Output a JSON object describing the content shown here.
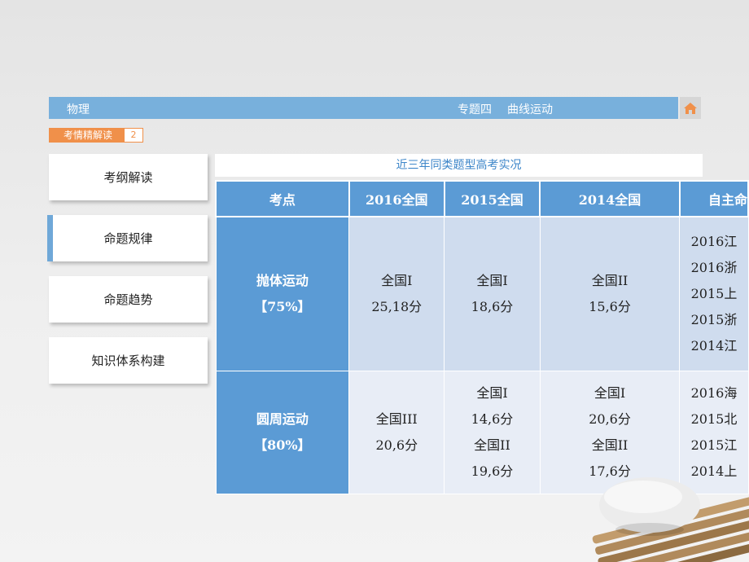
{
  "header": {
    "subject": "物理",
    "topic": "专题四",
    "subtopic": "曲线运动"
  },
  "section": {
    "label": "考情精解读",
    "number": "2"
  },
  "nav": [
    {
      "label": "考纲解读",
      "active": false
    },
    {
      "label": "命题规律",
      "active": true
    },
    {
      "label": "命题趋势",
      "active": false
    },
    {
      "label": "知识体系构建",
      "active": false
    }
  ],
  "table": {
    "caption": "近三年同类题型高考实况",
    "headers": [
      "考点",
      "2016全国",
      "2015全国",
      "2014全国",
      "自主命"
    ],
    "rows": [
      {
        "topic": "抛体运动",
        "percent": "【75%】",
        "cells": [
          [
            "全国I",
            "25,18分"
          ],
          [
            "全国I",
            "18,6分"
          ],
          [
            "全国II",
            "15,6分"
          ],
          [
            "2016江",
            "2016浙",
            "2015上",
            "2015浙",
            "2014江"
          ]
        ]
      },
      {
        "topic": "圆周运动",
        "percent": "【80%】",
        "cells": [
          [
            "全国III",
            "20,6分"
          ],
          [
            "全国I",
            "14,6分",
            "全国II",
            "19,6分"
          ],
          [
            "全国I",
            "20,6分",
            "全国II",
            "17,6分"
          ],
          [
            "2016海",
            "2015北",
            "2015江",
            "2014上"
          ]
        ]
      }
    ]
  },
  "colors": {
    "header_bar": "#78b0dc",
    "section_tag": "#f0904a",
    "table_header": "#5b9bd5",
    "row1_bg": "#cfdcee",
    "row2_bg": "#e8edf6",
    "caption_text": "#3d86c9"
  },
  "icons": {
    "home": "home-icon"
  }
}
